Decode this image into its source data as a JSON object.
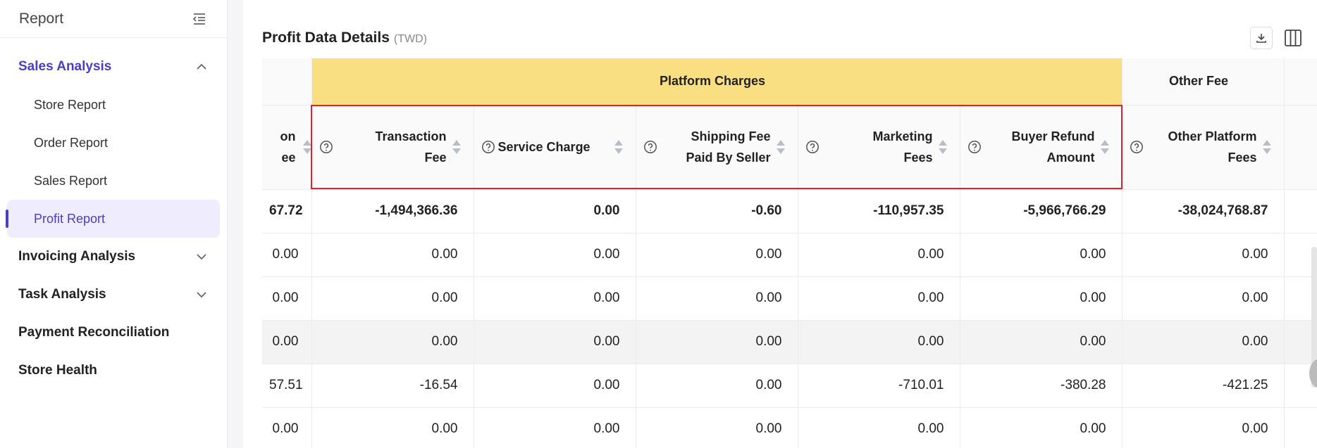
{
  "sidebar": {
    "title": "Report",
    "groups": [
      {
        "label": "Sales Analysis",
        "expanded": true
      },
      {
        "label": "Invoicing Analysis"
      },
      {
        "label": "Task Analysis"
      },
      {
        "label": "Payment Reconciliation"
      },
      {
        "label": "Store Health"
      }
    ],
    "sales_items": [
      "Store Report",
      "Order Report",
      "Sales Report",
      "Profit Report"
    ]
  },
  "main": {
    "title": "Profit Data Details",
    "currency": "(TWD)"
  },
  "table": {
    "group_headers": {
      "platform": "Platform Charges",
      "other": "Other Fee"
    },
    "partial_header": {
      "line1": "on",
      "line2": "ee"
    },
    "columns": [
      {
        "line1": "Transaction",
        "line2": "Fee"
      },
      {
        "line1": "Service Charge",
        "line2": ""
      },
      {
        "line1": "Shipping Fee",
        "line2": "Paid By Seller"
      },
      {
        "line1": "Marketing",
        "line2": "Fees"
      },
      {
        "line1": "Buyer Refund",
        "line2": "Amount"
      },
      {
        "line1": "Other Platform",
        "line2": "Fees"
      }
    ],
    "rows": [
      [
        "67.72",
        "-1,494,366.36",
        "0.00",
        "-0.60",
        "-110,957.35",
        "-5,966,766.29",
        "-38,024,768.87"
      ],
      [
        "0.00",
        "0.00",
        "0.00",
        "0.00",
        "0.00",
        "0.00",
        "0.00"
      ],
      [
        "0.00",
        "0.00",
        "0.00",
        "0.00",
        "0.00",
        "0.00",
        "0.00"
      ],
      [
        "0.00",
        "0.00",
        "0.00",
        "0.00",
        "0.00",
        "0.00",
        "0.00"
      ],
      [
        "57.51",
        "-16.54",
        "0.00",
        "0.00",
        "-710.01",
        "-380.28",
        "-421.25"
      ],
      [
        "0.00",
        "0.00",
        "0.00",
        "0.00",
        "0.00",
        "0.00",
        "0.00"
      ]
    ]
  },
  "colors": {
    "accent": "#4a3ec6",
    "platform_header": "#f9df82",
    "highlight_border": "#e0202c"
  }
}
